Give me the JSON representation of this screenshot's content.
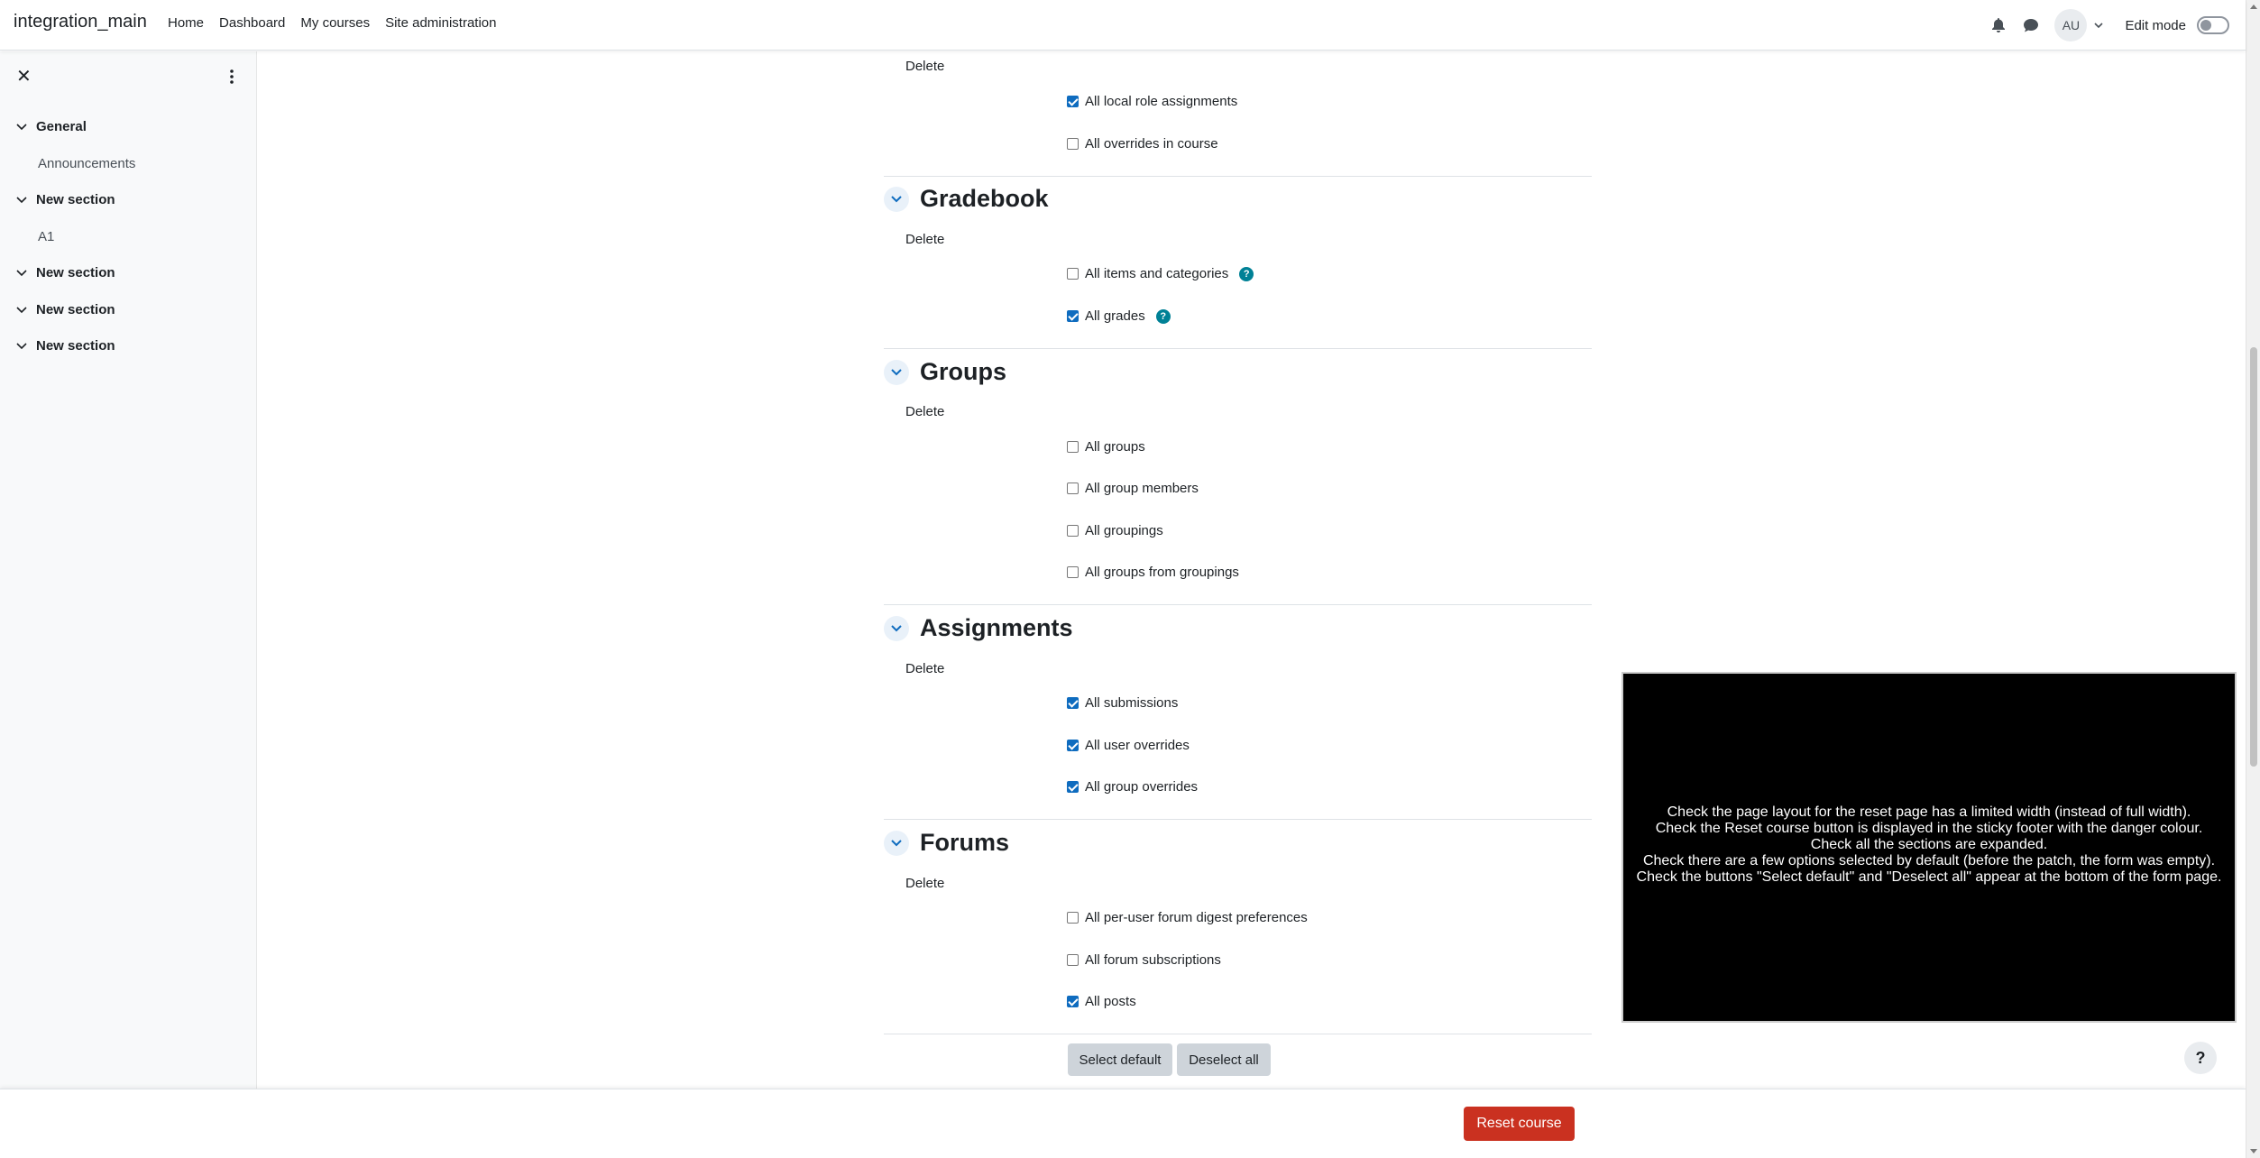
{
  "navbar": {
    "brand": "integration_main",
    "links": [
      "Home",
      "Dashboard",
      "My courses",
      "Site administration"
    ],
    "avatar_initials": "AU",
    "edit_mode_label": "Edit mode"
  },
  "drawer": {
    "items": [
      {
        "type": "section",
        "label": "General"
      },
      {
        "type": "activity",
        "label": "Announcements"
      },
      {
        "type": "section",
        "label": "New section"
      },
      {
        "type": "activity",
        "label": "A1"
      },
      {
        "type": "section",
        "label": "New section"
      },
      {
        "type": "section",
        "label": "New section"
      },
      {
        "type": "section",
        "label": "New section"
      }
    ]
  },
  "form": {
    "top": {
      "delete_label": "Delete",
      "options": [
        {
          "label": "All local role assignments",
          "checked": true
        },
        {
          "label": "All overrides in course",
          "checked": false
        }
      ]
    },
    "sections": [
      {
        "title": "Gradebook",
        "delete_label": "Delete",
        "options": [
          {
            "label": "All items and categories",
            "checked": false,
            "help": true
          },
          {
            "label": "All grades",
            "checked": true,
            "help": true
          }
        ]
      },
      {
        "title": "Groups",
        "delete_label": "Delete",
        "options": [
          {
            "label": "All groups",
            "checked": false
          },
          {
            "label": "All group members",
            "checked": false
          },
          {
            "label": "All groupings",
            "checked": false
          },
          {
            "label": "All groups from groupings",
            "checked": false
          }
        ]
      },
      {
        "title": "Assignments",
        "delete_label": "Delete",
        "options": [
          {
            "label": "All submissions",
            "checked": true
          },
          {
            "label": "All user overrides",
            "checked": true
          },
          {
            "label": "All group overrides",
            "checked": true
          }
        ]
      },
      {
        "title": "Forums",
        "delete_label": "Delete",
        "options": [
          {
            "label": "All per-user forum digest preferences",
            "checked": false
          },
          {
            "label": "All forum subscriptions",
            "checked": false
          },
          {
            "label": "All posts",
            "checked": true
          }
        ]
      }
    ],
    "select_default_label": "Select default",
    "deselect_all_label": "Deselect all"
  },
  "overlay": {
    "lines": [
      "Check the page layout for the reset page has a limited width (instead of full width).",
      "Check the Reset course button is displayed in the sticky footer with the danger colour.",
      "Check all the sections are expanded.",
      "Check there are a few options selected by default (before the patch, the form was empty).",
      "Check the buttons \"Select default\" and \"Deselect all\" appear at the bottom of the form page."
    ]
  },
  "help_fab_label": "?",
  "footer": {
    "reset_button_label": "Reset course"
  },
  "colors": {
    "primary": "#0f6cbf",
    "danger": "#ca3120",
    "help": "#008196",
    "drawer_bg": "#f8f9fa"
  },
  "icons": [
    "bell-icon",
    "chat-icon",
    "chevron-down-icon",
    "close-icon",
    "kebab-icon",
    "help-icon"
  ]
}
